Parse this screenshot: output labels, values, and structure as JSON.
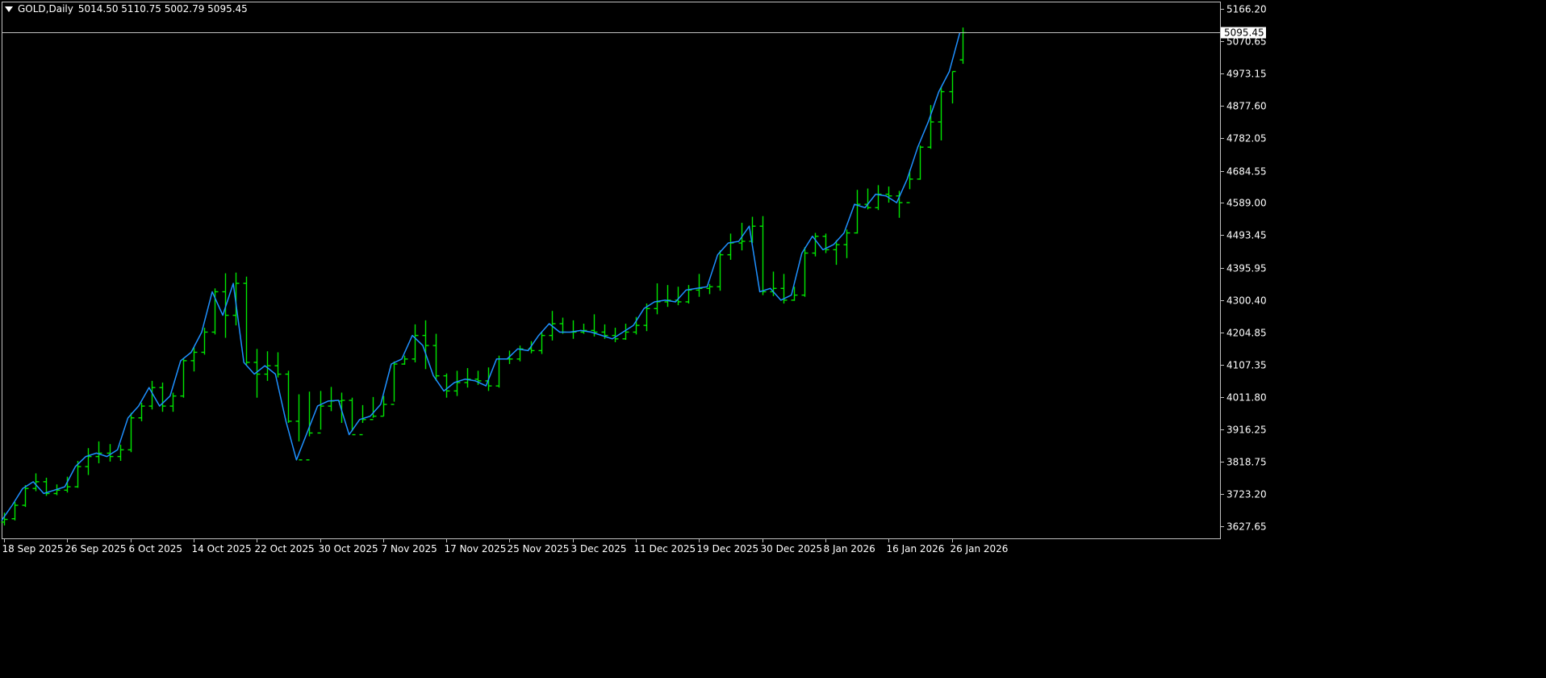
{
  "header": {
    "symbol": "GOLD,Daily",
    "ohlc": "5014.50 5110.75 5002.79 5095.45"
  },
  "price_marker": {
    "label": "5095.45",
    "value": 5095.45
  },
  "colors": {
    "background": "#000000",
    "bars": "#00e600",
    "line": "#1e90ff",
    "axis": "#c0c0c0",
    "text": "#ffffff"
  },
  "chart_data": {
    "type": "line",
    "title": "GOLD,Daily",
    "ylim": [
      3580,
      5180
    ],
    "yticks": [
      "5166.20",
      "5070.65",
      "4973.15",
      "4877.60",
      "4782.05",
      "4684.55",
      "4589.00",
      "4493.45",
      "4395.95",
      "4300.40",
      "4204.85",
      "4107.35",
      "4011.80",
      "3916.25",
      "3818.75",
      "3723.20",
      "3627.65"
    ],
    "xticks": [
      "18 Sep 2025",
      "26 Sep 2025",
      "6 Oct 2025",
      "14 Oct 2025",
      "22 Oct 2025",
      "30 Oct 2025",
      "7 Nov 2025",
      "17 Nov 2025",
      "25 Nov 2025",
      "3 Dec 2025",
      "11 Dec 2025",
      "19 Dec 2025",
      "30 Dec 2025",
      "8 Jan 2026",
      "16 Jan 2026",
      "26 Jan 2026"
    ],
    "legend": "none",
    "grid": false,
    "series": [
      {
        "values": [
          3645,
          3690,
          3740,
          3760,
          3725,
          3735,
          3745,
          3805,
          3835,
          3845,
          3835,
          3855,
          3950,
          3985,
          4040,
          3985,
          4015,
          4120,
          4145,
          4205,
          4325,
          4255,
          4350,
          4115,
          4080,
          4105,
          4080,
          3940,
          3825,
          3905,
          3985,
          4000,
          4002,
          3900,
          3945,
          3955,
          3990,
          4110,
          4125,
          4195,
          4165,
          4075,
          4030,
          4055,
          4065,
          4060,
          4045,
          4125,
          4125,
          4155,
          4150,
          4195,
          4230,
          4205,
          4205,
          4210,
          4205,
          4195,
          4185,
          4205,
          4225,
          4275,
          4295,
          4300,
          4295,
          4330,
          4335,
          4340,
          4435,
          4470,
          4475,
          4520,
          4325,
          4335,
          4300,
          4315,
          4440,
          4490,
          4450,
          4465,
          4500,
          4585,
          4575,
          4615,
          4610,
          4590,
          4660,
          4755,
          4830,
          4920,
          4980,
          5095
        ]
      }
    ],
    "bars": [
      {
        "open": 3640,
        "high": 3668,
        "low": 3630,
        "close": 3648
      },
      {
        "open": 3650,
        "high": 3700,
        "low": 3645,
        "close": 3690
      },
      {
        "open": 3690,
        "high": 3750,
        "low": 3685,
        "close": 3740
      },
      {
        "open": 3740,
        "high": 3785,
        "low": 3732,
        "close": 3760
      },
      {
        "open": 3760,
        "high": 3772,
        "low": 3718,
        "close": 3725
      },
      {
        "open": 3725,
        "high": 3752,
        "low": 3720,
        "close": 3735
      },
      {
        "open": 3735,
        "high": 3775,
        "low": 3728,
        "close": 3745
      },
      {
        "open": 3745,
        "high": 3822,
        "low": 3742,
        "close": 3805
      },
      {
        "open": 3805,
        "high": 3860,
        "low": 3780,
        "close": 3835
      },
      {
        "open": 3835,
        "high": 3880,
        "low": 3815,
        "close": 3845
      },
      {
        "open": 3845,
        "high": 3872,
        "low": 3820,
        "close": 3835
      },
      {
        "open": 3835,
        "high": 3870,
        "low": 3822,
        "close": 3855
      },
      {
        "open": 3855,
        "high": 3965,
        "low": 3848,
        "close": 3950
      },
      {
        "open": 3950,
        "high": 3995,
        "low": 3940,
        "close": 3985
      },
      {
        "open": 3985,
        "high": 4060,
        "low": 3975,
        "close": 4040
      },
      {
        "open": 4040,
        "high": 4055,
        "low": 3968,
        "close": 3985
      },
      {
        "open": 3985,
        "high": 4025,
        "low": 3968,
        "close": 4015
      },
      {
        "open": 4015,
        "high": 4128,
        "low": 4010,
        "close": 4120
      },
      {
        "open": 4120,
        "high": 4160,
        "low": 4088,
        "close": 4145
      },
      {
        "open": 4145,
        "high": 4218,
        "low": 4138,
        "close": 4205
      },
      {
        "open": 4205,
        "high": 4335,
        "low": 4198,
        "close": 4325
      },
      {
        "open": 4325,
        "high": 4380,
        "low": 4188,
        "close": 4255
      },
      {
        "open": 4255,
        "high": 4382,
        "low": 4225,
        "close": 4350
      },
      {
        "open": 4350,
        "high": 4370,
        "low": 4108,
        "close": 4115
      },
      {
        "open": 4115,
        "high": 4155,
        "low": 4010,
        "close": 4080
      },
      {
        "open": 4080,
        "high": 4148,
        "low": 4060,
        "close": 4105
      },
      {
        "open": 4105,
        "high": 4145,
        "low": 4070,
        "close": 4080
      },
      {
        "open": 4080,
        "high": 4090,
        "low": 3935,
        "close": 3940
      },
      {
        "open": 3940,
        "high": 4020,
        "low": 3880,
        "close": 3825
      },
      {
        "open": 3825,
        "high": 4028,
        "low": 3895,
        "close": 3905
      },
      {
        "open": 3905,
        "high": 4030,
        "low": 3915,
        "close": 3985
      },
      {
        "open": 3985,
        "high": 4042,
        "low": 3970,
        "close": 4000
      },
      {
        "open": 4000,
        "high": 4025,
        "low": 3935,
        "close": 4002
      },
      {
        "open": 4002,
        "high": 4010,
        "low": 3910,
        "close": 3900
      },
      {
        "open": 3900,
        "high": 3988,
        "low": 3935,
        "close": 3945
      },
      {
        "open": 3945,
        "high": 4012,
        "low": 3950,
        "close": 3955
      },
      {
        "open": 3955,
        "high": 4015,
        "low": 3955,
        "close": 3990
      },
      {
        "open": 3990,
        "high": 4118,
        "low": 3998,
        "close": 4110
      },
      {
        "open": 4110,
        "high": 4135,
        "low": 4108,
        "close": 4125
      },
      {
        "open": 4125,
        "high": 4228,
        "low": 4115,
        "close": 4195
      },
      {
        "open": 4195,
        "high": 4240,
        "low": 4095,
        "close": 4165
      },
      {
        "open": 4165,
        "high": 4200,
        "low": 4060,
        "close": 4075
      },
      {
        "open": 4075,
        "high": 4082,
        "low": 4010,
        "close": 4030
      },
      {
        "open": 4030,
        "high": 4090,
        "low": 4015,
        "close": 4055
      },
      {
        "open": 4055,
        "high": 4098,
        "low": 4040,
        "close": 4065
      },
      {
        "open": 4065,
        "high": 4090,
        "low": 4048,
        "close": 4060
      },
      {
        "open": 4060,
        "high": 4100,
        "low": 4030,
        "close": 4045
      },
      {
        "open": 4045,
        "high": 4135,
        "low": 4040,
        "close": 4125
      },
      {
        "open": 4125,
        "high": 4150,
        "low": 4110,
        "close": 4125
      },
      {
        "open": 4125,
        "high": 4165,
        "low": 4118,
        "close": 4155
      },
      {
        "open": 4155,
        "high": 4178,
        "low": 4142,
        "close": 4150
      },
      {
        "open": 4150,
        "high": 4205,
        "low": 4140,
        "close": 4195
      },
      {
        "open": 4195,
        "high": 4268,
        "low": 4180,
        "close": 4230
      },
      {
        "open": 4230,
        "high": 4248,
        "low": 4200,
        "close": 4205
      },
      {
        "open": 4205,
        "high": 4240,
        "low": 4185,
        "close": 4205
      },
      {
        "open": 4205,
        "high": 4230,
        "low": 4200,
        "close": 4210
      },
      {
        "open": 4210,
        "high": 4258,
        "low": 4192,
        "close": 4205
      },
      {
        "open": 4205,
        "high": 4228,
        "low": 4185,
        "close": 4195
      },
      {
        "open": 4195,
        "high": 4218,
        "low": 4175,
        "close": 4185
      },
      {
        "open": 4185,
        "high": 4230,
        "low": 4182,
        "close": 4205
      },
      {
        "open": 4205,
        "high": 4250,
        "low": 4198,
        "close": 4225
      },
      {
        "open": 4225,
        "high": 4290,
        "low": 4208,
        "close": 4275
      },
      {
        "open": 4275,
        "high": 4350,
        "low": 4258,
        "close": 4295
      },
      {
        "open": 4295,
        "high": 4345,
        "low": 4280,
        "close": 4300
      },
      {
        "open": 4300,
        "high": 4340,
        "low": 4285,
        "close": 4295
      },
      {
        "open": 4295,
        "high": 4345,
        "low": 4290,
        "close": 4330
      },
      {
        "open": 4330,
        "high": 4378,
        "low": 4310,
        "close": 4335
      },
      {
        "open": 4335,
        "high": 4348,
        "low": 4318,
        "close": 4340
      },
      {
        "open": 4340,
        "high": 4448,
        "low": 4328,
        "close": 4435
      },
      {
        "open": 4435,
        "high": 4498,
        "low": 4420,
        "close": 4470
      },
      {
        "open": 4470,
        "high": 4530,
        "low": 4448,
        "close": 4475
      },
      {
        "open": 4475,
        "high": 4548,
        "low": 4470,
        "close": 4520
      },
      {
        "open": 4520,
        "high": 4550,
        "low": 4315,
        "close": 4325
      },
      {
        "open": 4325,
        "high": 4385,
        "low": 4312,
        "close": 4335
      },
      {
        "open": 4335,
        "high": 4378,
        "low": 4290,
        "close": 4300
      },
      {
        "open": 4300,
        "high": 4340,
        "low": 4298,
        "close": 4315
      },
      {
        "open": 4315,
        "high": 4458,
        "low": 4310,
        "close": 4440
      },
      {
        "open": 4440,
        "high": 4500,
        "low": 4430,
        "close": 4490
      },
      {
        "open": 4490,
        "high": 4498,
        "low": 4440,
        "close": 4450
      },
      {
        "open": 4450,
        "high": 4478,
        "low": 4405,
        "close": 4465
      },
      {
        "open": 4465,
        "high": 4510,
        "low": 4425,
        "close": 4500
      },
      {
        "open": 4500,
        "high": 4628,
        "low": 4498,
        "close": 4585
      },
      {
        "open": 4585,
        "high": 4632,
        "low": 4570,
        "close": 4575
      },
      {
        "open": 4575,
        "high": 4642,
        "low": 4568,
        "close": 4615
      },
      {
        "open": 4615,
        "high": 4638,
        "low": 4590,
        "close": 4610
      },
      {
        "open": 4610,
        "high": 4625,
        "low": 4545,
        "close": 4590
      },
      {
        "open": 4590,
        "high": 4688,
        "low": 4630,
        "close": 4660
      },
      {
        "open": 4660,
        "high": 4760,
        "low": 4658,
        "close": 4755
      },
      {
        "open": 4755,
        "high": 4880,
        "low": 4750,
        "close": 4830
      },
      {
        "open": 4830,
        "high": 4935,
        "low": 4775,
        "close": 4920
      },
      {
        "open": 4920,
        "high": 4980,
        "low": 4885,
        "close": 4980
      },
      {
        "open": 5014.5,
        "high": 5110.75,
        "low": 5002.79,
        "close": 5095.45
      }
    ]
  }
}
